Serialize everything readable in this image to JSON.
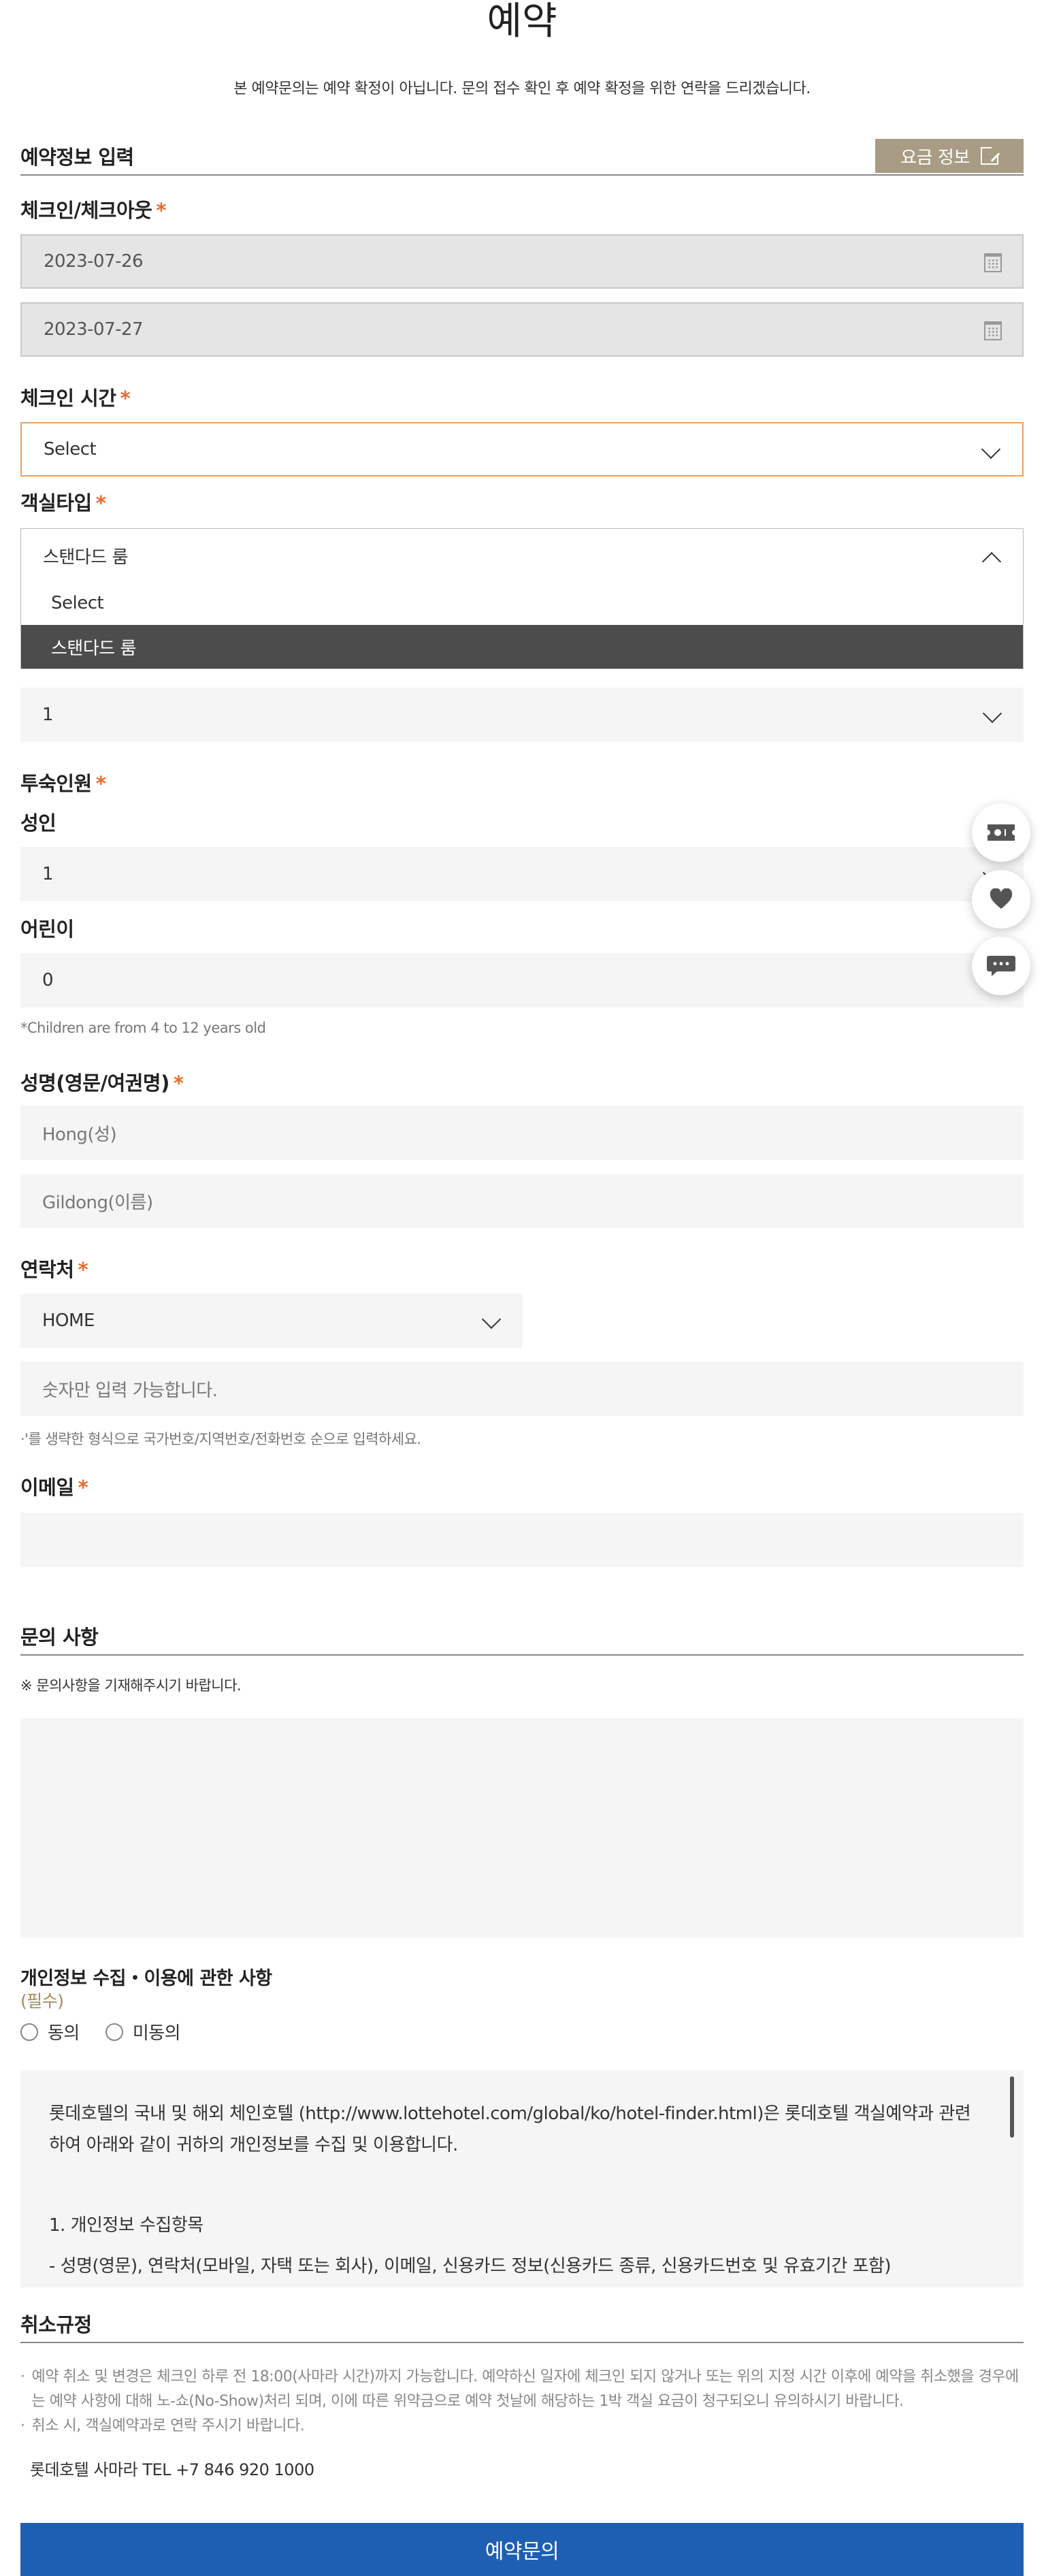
{
  "page": {
    "title": "예약",
    "notice": "본 예약문의는 예약 확정이 아닙니다. 문의 접수 확인 후 예약 확정을 위한 연락을 드리겠습니다."
  },
  "reservation_info": {
    "heading": "예약정보 입력",
    "rate_button": "요금 정보"
  },
  "checkin_checkout": {
    "label": "체크인/체크아웃",
    "required_mark": "*",
    "checkin_date": "2023-07-26",
    "checkout_date": "2023-07-27"
  },
  "checkin_time": {
    "label": "체크인 시간",
    "required_mark": "*",
    "value": "Select"
  },
  "room_type": {
    "label": "객실타입",
    "required_mark": "*",
    "value": "스탠다드 룸",
    "options": [
      "Select",
      "스탠다드 룸"
    ],
    "selected_index": 1
  },
  "rooms": {
    "value": "1"
  },
  "guests": {
    "label": "투숙인원",
    "required_mark": "*",
    "adult_label": "성인",
    "adult_value": "1",
    "child_label": "어린이",
    "child_value": "0",
    "child_hint": "*Children are from 4 to 12 years old"
  },
  "name": {
    "label": "성명(영문/여권명)",
    "required_mark": "*",
    "last_placeholder": "Hong(성)",
    "first_placeholder": "Gildong(이름)"
  },
  "contact": {
    "label": "연락처",
    "required_mark": "*",
    "type_value": "HOME",
    "number_placeholder": "숫자만 입력 가능합니다.",
    "hint": "·'를 생략한 형식으로 국가번호/지역번호/전화번호 순으로 입력하세요."
  },
  "email": {
    "label": "이메일",
    "required_mark": "*",
    "value": ""
  },
  "inquiry": {
    "heading": "문의 사항",
    "hint": "※ 문의사항을 기재해주시기 바랍니다.",
    "value": ""
  },
  "privacy": {
    "heading": "개인정보 수집・이용에 관한 사항",
    "required_text": "(필수)",
    "agree_label": "동의",
    "disagree_label": "미동의",
    "body_intro": "롯데호텔의 국내 및 해외 체인호텔 (http://www.lottehotel.com/global/ko/hotel-finder.html)은 롯데호텔 객실예약과 관련하여 아래와 같이 귀하의 개인정보를 수집 및 이용합니다.",
    "body_heading": "1. 개인정보 수집항목",
    "body_item": "- 성명(영문), 연락처(모바일, 자택 또는 회사), 이메일, 신용카드 정보(신용카드 종류, 신용카드번호 및 유효기간 포함)"
  },
  "cancellation": {
    "heading": "취소규정",
    "items": [
      "예약 취소 및 변경은 체크인 하루 전 18:00(사마라 시간)까지 가능합니다. 예약하신 일자에 체크인 되지 않거나 또는 위의 지정 시간 이후에 예약을 취소했을 경우에는 예약 사항에 대해 노-쇼(No-Show)처리 되며, 이에 따른 위약금으로 예약 첫날에 해당하는 1박 객실 요금이 청구되오니 유의하시기 바랍니다.",
      "취소 시, 객실예약과로 연락 주시기 바랍니다."
    ],
    "bullet": "·",
    "tel": "롯데호텔 사마라 TEL +7 846 920 1000"
  },
  "submit_label": "예약문의",
  "colors": {
    "accent_orange": "#e86a2c",
    "rate_button_bg": "#a89c85",
    "submit_bg": "#1f5fb3",
    "selected_option_bg": "#4c4c4c"
  },
  "floating_icons": [
    "ticket-icon",
    "heart-icon",
    "chat-icon"
  ]
}
